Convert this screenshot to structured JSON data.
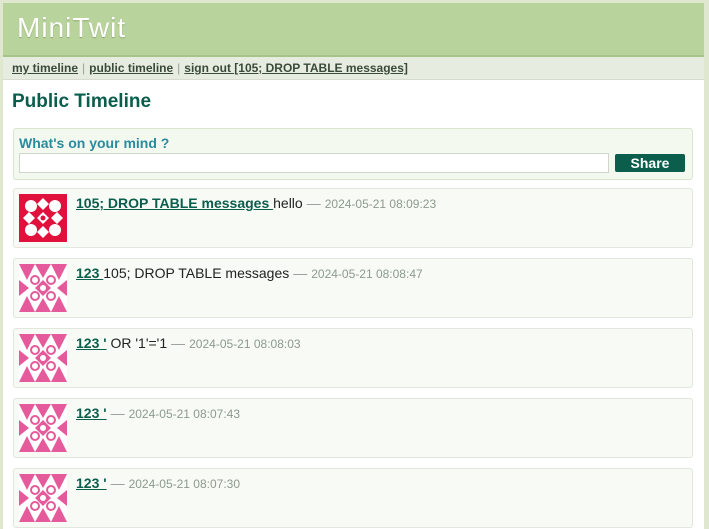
{
  "brand": "MiniTwit",
  "nav": {
    "my_timeline": "my timeline",
    "public_timeline": "public timeline",
    "sign_out": "sign out [105; DROP TABLE messages]",
    "separator": "|"
  },
  "page_title": "Public Timeline",
  "twitbox": {
    "prompt": "What's on your mind ?",
    "input_value": "",
    "share_label": "Share"
  },
  "messages": [
    {
      "user": "105; DROP TABLE messages ",
      "text": "hello",
      "timestamp": "2024-05-21 08:09:23"
    },
    {
      "user": "123 ",
      "text": "105; DROP TABLE messages",
      "timestamp": "2024-05-21 08:08:47"
    },
    {
      "user": "123 '",
      "text": " OR '1'='1",
      "timestamp": "2024-05-21 08:08:03"
    },
    {
      "user": "123 '",
      "text": "",
      "timestamp": "2024-05-21 08:07:43"
    },
    {
      "user": "123 '",
      "text": "",
      "timestamp": "2024-05-21 08:07:30"
    }
  ],
  "dash": "—",
  "colors": {
    "accent": "#0b5d4c",
    "header": "#b9d39c",
    "avatar_red": "#e0113d",
    "avatar_pink": "#e55a9a"
  }
}
